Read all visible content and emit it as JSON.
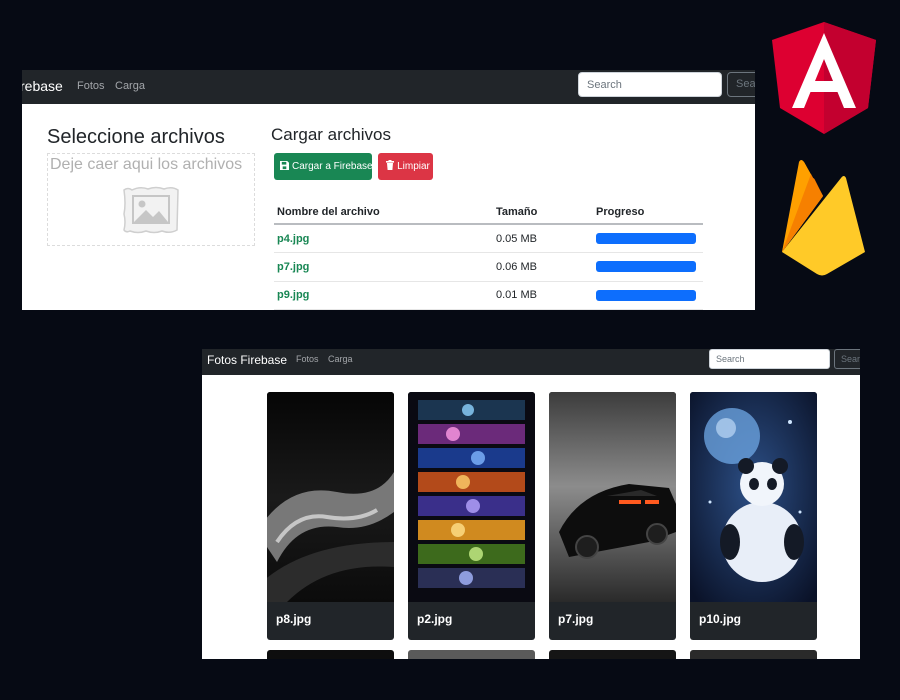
{
  "upload_page": {
    "navbar": {
      "brand": "rebase",
      "links": [
        "Fotos",
        "Carga"
      ],
      "search_placeholder": "Search",
      "search_button": "Sear"
    },
    "dropzone": {
      "title": "Seleccione archivos",
      "hint": "Deje caer aqui los archivos",
      "icon": "image-placeholder-icon"
    },
    "uploader": {
      "title": "Cargar archivos",
      "upload_button": "Cargar a Firebase",
      "clear_button": "Limpiar",
      "upload_icon": "save-icon",
      "clear_icon": "trash-icon"
    },
    "table": {
      "headers": [
        "Nombre del archivo",
        "Tamaño",
        "Progreso"
      ],
      "rows": [
        {
          "name": "p4.jpg",
          "size": "0.05 MB",
          "progress": 100
        },
        {
          "name": "p7.jpg",
          "size": "0.06 MB",
          "progress": 100
        },
        {
          "name": "p9.jpg",
          "size": "0.01 MB",
          "progress": 100
        }
      ]
    }
  },
  "gallery_page": {
    "navbar": {
      "brand": "Fotos Firebase",
      "links": [
        "Fotos",
        "Carga"
      ],
      "search_placeholder": "Search",
      "search_button": "Sear"
    },
    "photos": [
      {
        "caption": "p8.jpg"
      },
      {
        "caption": "p2.jpg"
      },
      {
        "caption": "p7.jpg"
      },
      {
        "caption": "p10.jpg"
      }
    ]
  },
  "logos": [
    "angular-logo",
    "firebase-logo"
  ],
  "colors": {
    "background": "#060a14",
    "navbar": "#212529",
    "success": "#198754",
    "danger": "#dc3545",
    "progress": "#0d6efd",
    "angular": "#dd0031",
    "firebase_yellow": "#ffca28",
    "firebase_orange": "#f57c00"
  }
}
